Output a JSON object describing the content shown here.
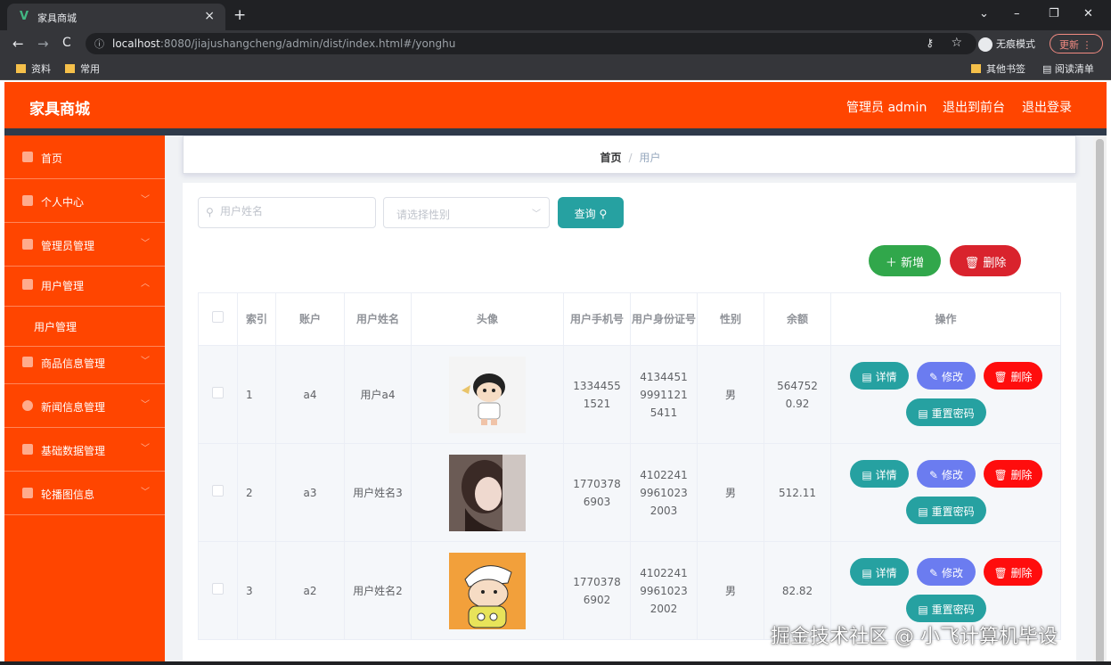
{
  "browser": {
    "tab_title": "家具商城",
    "tab_favicon": "V",
    "url_host": "localhost",
    "url_rest": ":8080/jiajushangcheng/admin/dist/index.html#/yonghu",
    "incognito_label": "无痕模式",
    "update_label": "更新",
    "bookmarks": [
      "资料",
      "常用"
    ],
    "bookmarks_right": [
      "其他书签",
      "阅读清单"
    ]
  },
  "header": {
    "brand": "家具商城",
    "admin_label": "管理员 admin",
    "to_front_label": "退出到前台",
    "logout_label": "退出登录",
    "color": "#ff4500"
  },
  "sidebar": {
    "items": [
      {
        "label": "首页",
        "icon": "home-icon"
      },
      {
        "label": "个人中心",
        "icon": "user-icon"
      },
      {
        "label": "管理员管理",
        "icon": "admin-icon"
      },
      {
        "label": "用户管理",
        "icon": "users-icon"
      },
      {
        "label": "商品信息管理",
        "icon": "goods-icon"
      },
      {
        "label": "新闻信息管理",
        "icon": "compass-icon"
      },
      {
        "label": "基础数据管理",
        "icon": "list-icon"
      },
      {
        "label": "轮播图信息",
        "icon": "image-icon"
      }
    ],
    "sub_item": "用户管理"
  },
  "breadcrumb": {
    "home": "首页",
    "current": "用户"
  },
  "search": {
    "name_placeholder": "用户姓名",
    "gender_placeholder": "请选择性别",
    "query_label": "查询"
  },
  "actions": {
    "add_label": "新增",
    "delete_label": "删除"
  },
  "table": {
    "headers": [
      "索引",
      "账户",
      "用户姓名",
      "头像",
      "用户手机号",
      "用户身份证号",
      "性别",
      "余额",
      "操作"
    ],
    "rows": [
      {
        "index": "1",
        "account": "a4",
        "name": "用户a4",
        "phone": "13344551521",
        "id_card": "413445199911215411",
        "gender": "男",
        "balance": "5647520.92"
      },
      {
        "index": "2",
        "account": "a3",
        "name": "用户姓名3",
        "phone": "17703786903",
        "id_card": "410224199610232003",
        "gender": "男",
        "balance": "512.11"
      },
      {
        "index": "3",
        "account": "a2",
        "name": "用户姓名2",
        "phone": "17703786902",
        "id_card": "410224199610232002",
        "gender": "男",
        "balance": "82.82"
      }
    ],
    "op_detail": "详情",
    "op_edit": "修改",
    "op_delete": "删除",
    "op_reset": "重置密码"
  },
  "watermark": "掘金技术社区 @ 小飞计算机毕设"
}
